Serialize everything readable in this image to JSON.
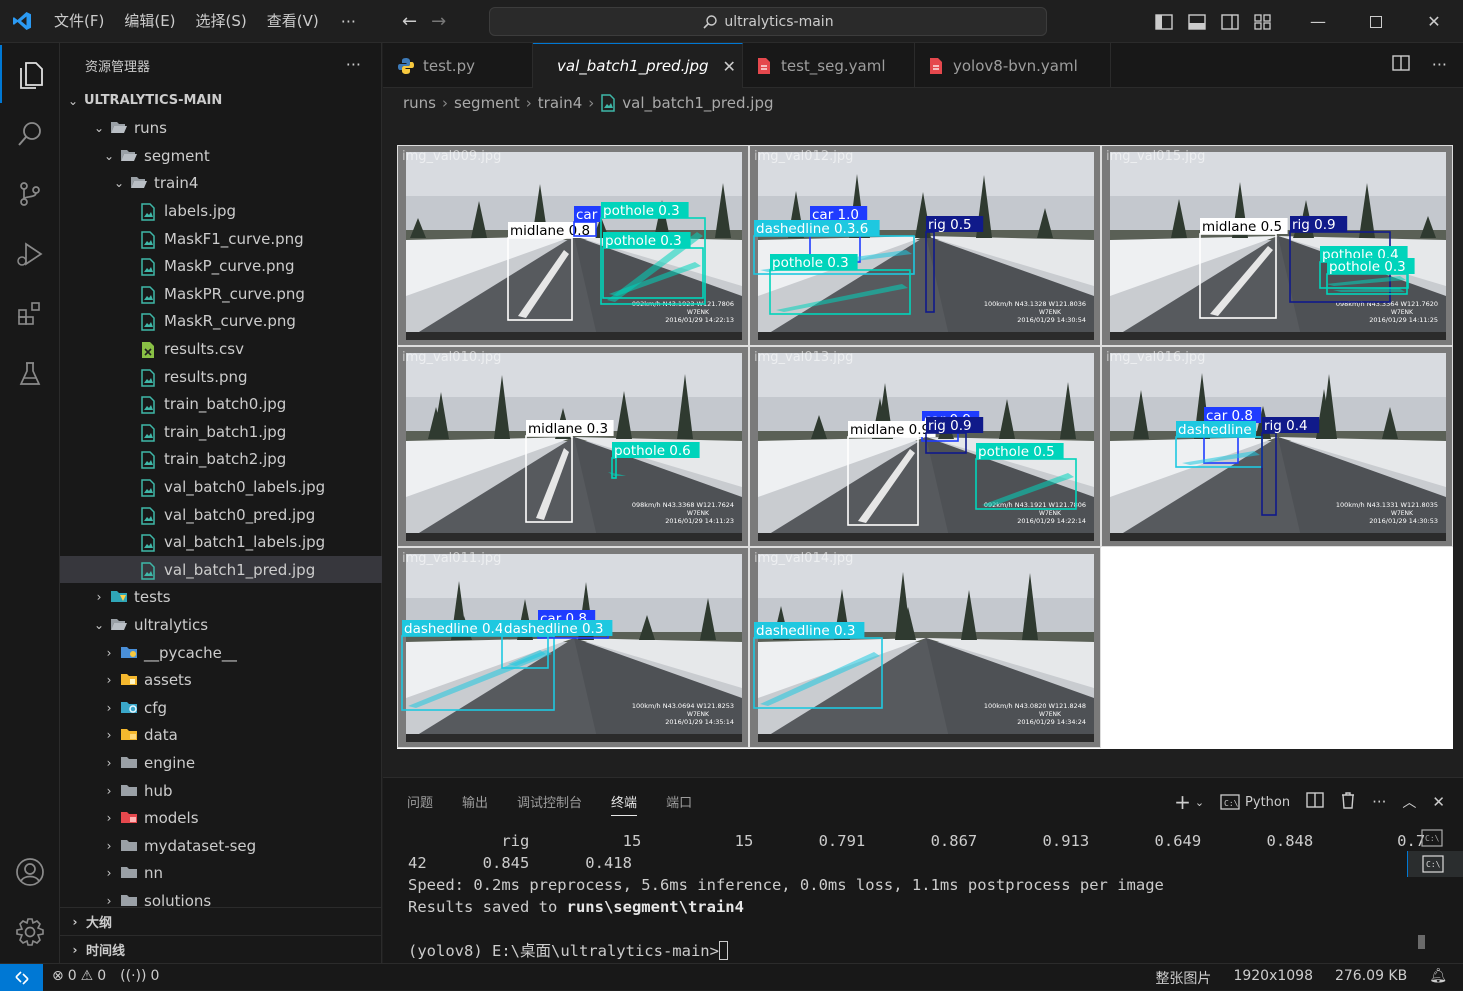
{
  "menu": [
    "文件(F)",
    "编辑(E)",
    "选择(S)",
    "查看(V)"
  ],
  "search": {
    "text": "ultralytics-main"
  },
  "sidebar": {
    "title": "资源管理器",
    "root": "ULTRALYTICS-MAIN",
    "items": [
      {
        "label": "runs"
      },
      {
        "label": "segment"
      },
      {
        "label": "train4"
      },
      {
        "label": "labels.jpg"
      },
      {
        "label": "MaskF1_curve.png"
      },
      {
        "label": "MaskP_curve.png"
      },
      {
        "label": "MaskPR_curve.png"
      },
      {
        "label": "MaskR_curve.png"
      },
      {
        "label": "results.csv"
      },
      {
        "label": "results.png"
      },
      {
        "label": "train_batch0.jpg"
      },
      {
        "label": "train_batch1.jpg"
      },
      {
        "label": "train_batch2.jpg"
      },
      {
        "label": "val_batch0_labels.jpg"
      },
      {
        "label": "val_batch0_pred.jpg"
      },
      {
        "label": "val_batch1_labels.jpg"
      },
      {
        "label": "val_batch1_pred.jpg"
      },
      {
        "label": "tests"
      },
      {
        "label": "ultralytics"
      },
      {
        "label": "__pycache__"
      },
      {
        "label": "assets"
      },
      {
        "label": "cfg"
      },
      {
        "label": "data"
      },
      {
        "label": "engine"
      },
      {
        "label": "hub"
      },
      {
        "label": "models"
      },
      {
        "label": "mydataset-seg"
      },
      {
        "label": "nn"
      },
      {
        "label": "solutions"
      }
    ],
    "outline": "大纲",
    "timeline": "时间线"
  },
  "tabs": [
    {
      "label": "test.py"
    },
    {
      "label": "val_batch1_pred.jpg"
    },
    {
      "label": "test_seg.yaml"
    },
    {
      "label": "yolov8-bvn.yaml"
    }
  ],
  "breadcrumb": [
    "runs",
    "segment",
    "train4",
    "val_batch1_pred.jpg"
  ],
  "images": [
    {
      "name": "img_val009.jpg",
      "stamp1": "092km/h N43.1923 W121.7806",
      "stamp2": "W7ENK",
      "stamp3": "2016/01/29 14:22:13",
      "labels": [
        "midlane 0.8",
        "car",
        "pothole 0.3",
        "pothole 0.3"
      ]
    },
    {
      "name": "img_val012.jpg",
      "stamp1": "100km/h N43.1328 W121.8036",
      "stamp2": "W7ENK",
      "stamp3": "2016/01/29 14:30:54",
      "labels": [
        "car 1.0",
        "dashedline 0.3.6",
        "rig 0.5",
        "pothole 0.3"
      ]
    },
    {
      "name": "img_val015.jpg",
      "stamp1": "098km/h N43.3364 W121.7620",
      "stamp2": "W7ENK",
      "stamp3": "2016/01/29 14:11:25",
      "labels": [
        "midlane 0.5",
        "rig 0.9",
        "pothole 0.4",
        "pothole 0.3"
      ]
    },
    {
      "name": "img_val010.jpg",
      "stamp1": "098km/h N43.3368 W121.7624",
      "stamp2": "W7ENK",
      "stamp3": "2016/01/29 14:11:23",
      "labels": [
        "midlane 0.3",
        "pothole 0.6"
      ]
    },
    {
      "name": "img_val013.jpg",
      "stamp1": "092km/h N43.1921 W121.7806",
      "stamp2": "W7ENK",
      "stamp3": "2016/01/29 14:22:14",
      "labels": [
        "car 0.9",
        "midlane 0.9",
        "rig 0.9",
        "pothole 0.5"
      ]
    },
    {
      "name": "img_val016.jpg",
      "stamp1": "100km/h N43.1331 W121.8035",
      "stamp2": "W7ENK",
      "stamp3": "2016/01/29 14:30:53",
      "labels": [
        "car 0.8",
        "dashedline",
        "rig 0.4"
      ]
    },
    {
      "name": "img_val011.jpg",
      "stamp1": "100km/h N43.0694 W121.8253",
      "stamp2": "W7ENK",
      "stamp3": "2016/01/29 14:35:14",
      "labels": [
        "dashedline 0.4",
        "car 0.8",
        "dashedline 0.3"
      ]
    },
    {
      "name": "img_val014.jpg",
      "stamp1": "100km/h N43.0820 W121.8248",
      "stamp2": "W7ENK",
      "stamp3": "2016/01/29 14:34:24",
      "labels": [
        "dashedline 0.3"
      ]
    }
  ],
  "panel": {
    "tabs": [
      "问题",
      "输出",
      "调试控制台",
      "终端",
      "端口"
    ],
    "active_tab": "终端",
    "shell": "Python",
    "lines": [
      "          rig          15          15       0.791       0.867       0.913       0.649       0.848         0.7",
      "42      0.845      0.418",
      "Speed: 0.2ms preprocess, 5.6ms inference, 0.0ms loss, 1.1ms postprocess per image"
    ],
    "saved_prefix": "Results saved to ",
    "saved_path": "runs\\segment\\train4",
    "prompt": "(yolov8) E:\\桌面\\ultralytics-main>"
  },
  "status": {
    "errors": "0",
    "warnings": "0",
    "ports": "0",
    "mode": "整张图片",
    "dimensions": "1920x1098",
    "size": "276.09 KB"
  },
  "colors": {
    "accent": "#0078d4",
    "pothole": "#00d4bb",
    "midlane": "#ffffff",
    "car": "#1f3cff",
    "rig": "#101a8a",
    "dashedline": "#1ec8e0"
  }
}
